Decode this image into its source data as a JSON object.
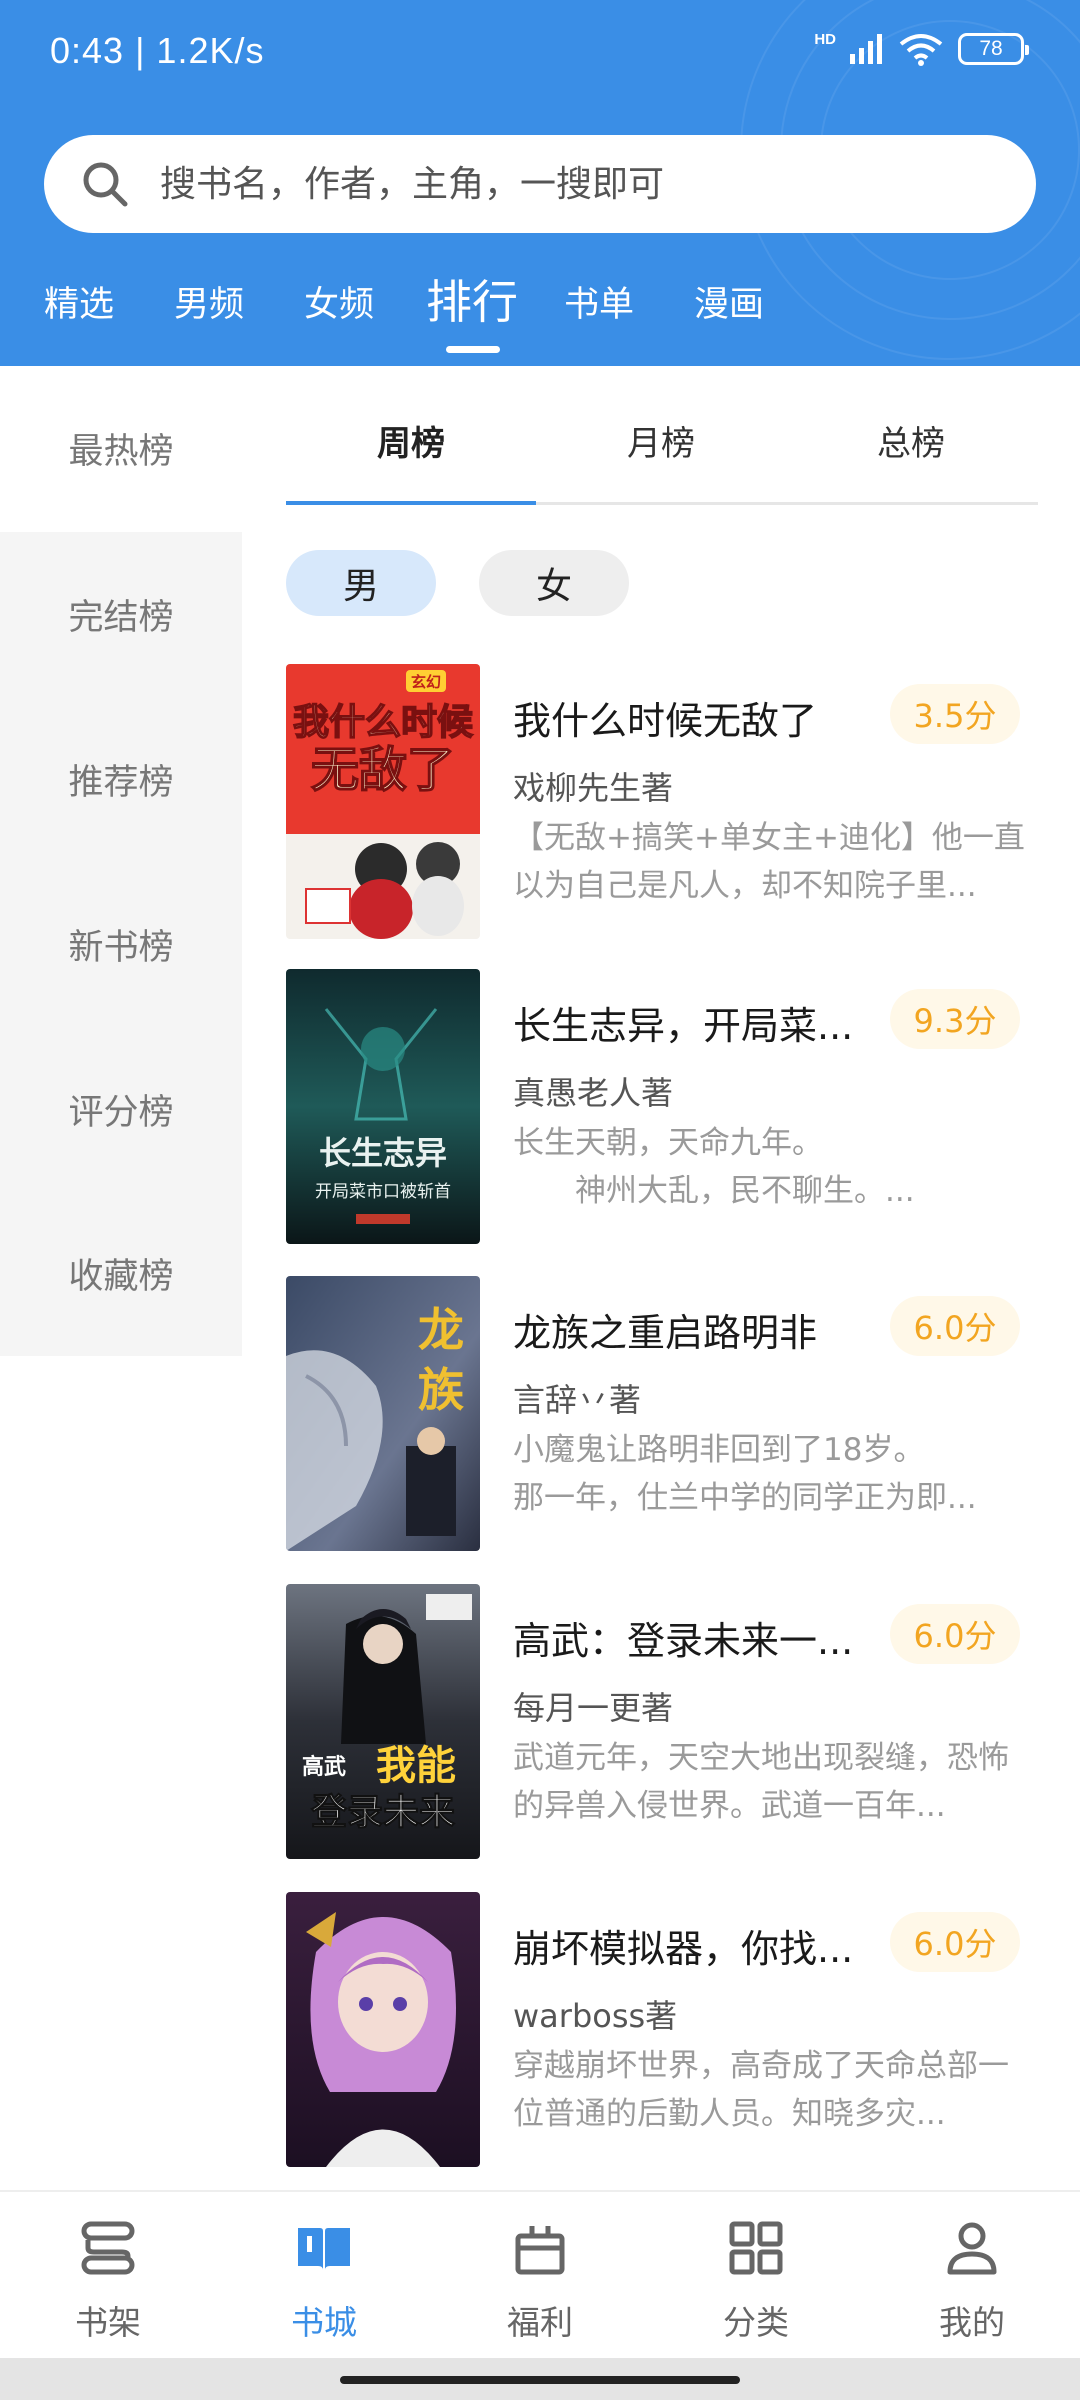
{
  "status": {
    "time_speed": "0:43 | 1.2K/s",
    "hd": "HD",
    "battery": "78"
  },
  "search": {
    "placeholder": "搜书名，作者，主角，一搜即可"
  },
  "top_tabs": [
    "精选",
    "男频",
    "女频",
    "排行",
    "书单",
    "漫画"
  ],
  "top_tabs_active": "排行",
  "rank_sidebar": [
    "最热榜",
    "完结榜",
    "推荐榜",
    "新书榜",
    "评分榜",
    "收藏榜"
  ],
  "rank_active": "最热榜",
  "period_tabs": [
    "周榜",
    "月榜",
    "总榜"
  ],
  "period_active": "周榜",
  "gender": {
    "male": "男",
    "female": "女",
    "active": "男"
  },
  "books": [
    {
      "title": "我什么时候无敌了",
      "score": "3.5分",
      "author": "戏柳先生著",
      "desc": "【无敌+搞笑+单女主+迪化】他一直以为自己是凡人，却不知院子里..."
    },
    {
      "title": "长生志异，开局菜...",
      "score": "9.3分",
      "author": "真愚老人著",
      "desc": "长生天朝，天命九年。\n　　神州大乱，民不聊生。..."
    },
    {
      "title": "龙族之重启路明非",
      "score": "6.0分",
      "author": "言辞丷著",
      "desc": "小魔鬼让路明非回到了18岁。\n那一年，仕兰中学的同学正为即..."
    },
    {
      "title": "高武：登录未来一...",
      "score": "6.0分",
      "author": "每月一更著",
      "desc": "武道元年，天空大地出现裂缝，恐怖的异兽入侵世界。武道一百年..."
    },
    {
      "title": "崩坏模拟器，你找...",
      "score": "6.0分",
      "author": "warboss著",
      "desc": "穿越崩坏世界，高奇成了天命总部一位普通的后勤人员。知晓多灾..."
    }
  ],
  "covers": {
    "book1": {
      "line1": "我什么时候",
      "line2": "无敌了",
      "tag": "玄幻"
    },
    "book2": {
      "line1": "长生志异",
      "line2": "开局菜市口被斩首"
    },
    "book3": {
      "line1": "龙",
      "line2": "族"
    },
    "book4": {
      "line1": "我能",
      "line2": "登录未来",
      "tag": "高武"
    },
    "book5": {}
  },
  "bottom_nav": [
    "书架",
    "书城",
    "福利",
    "分类",
    "我的"
  ],
  "bottom_nav_active": "书城",
  "colors": {
    "brand": "#3a8ee6",
    "score": "#f2a521",
    "score_bg": "#fff8e8",
    "chip_active": "#d7e8fb"
  }
}
